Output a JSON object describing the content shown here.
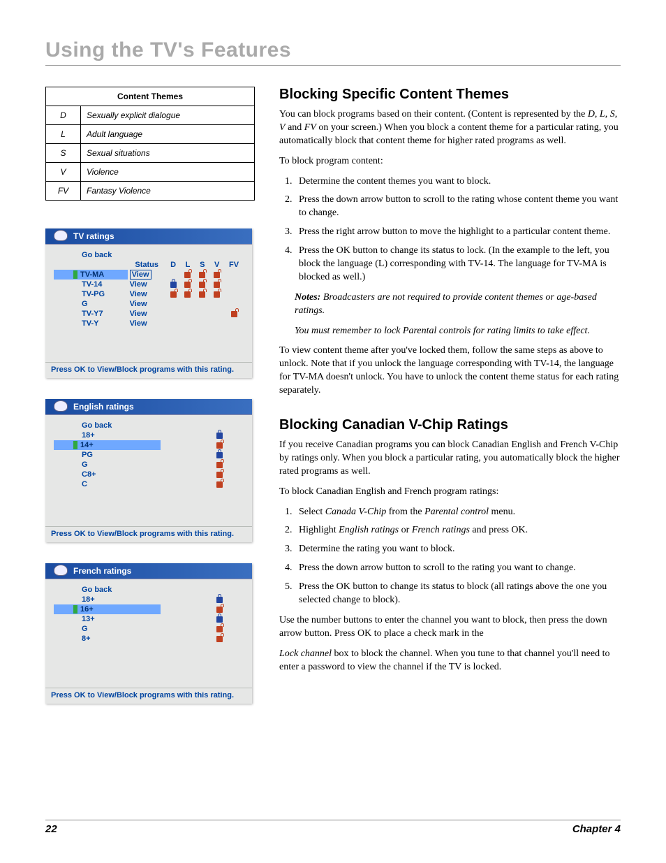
{
  "header": {
    "title": "Using the TV's Features"
  },
  "content_themes": {
    "title": "Content Themes",
    "rows": [
      {
        "code": "D",
        "label": "Sexually explicit dialogue"
      },
      {
        "code": "L",
        "label": "Adult language"
      },
      {
        "code": "S",
        "label": "Sexual situations"
      },
      {
        "code": "V",
        "label": "Violence"
      },
      {
        "code": "FV",
        "label": "Fantasy Violence"
      }
    ]
  },
  "tv_ratings_menu": {
    "title": "TV ratings",
    "go_back": "Go back",
    "columns": [
      "Status",
      "D",
      "L",
      "S",
      "V",
      "FV"
    ],
    "rows": [
      {
        "name": "TV-MA",
        "status": "View",
        "highlight": true,
        "boxed": true,
        "icons": [
          "",
          "unlock",
          "unlock",
          "unlock",
          ""
        ]
      },
      {
        "name": "TV-14",
        "status": "View",
        "highlight": false,
        "boxed": false,
        "icons": [
          "lock",
          "unlock",
          "unlock",
          "unlock",
          ""
        ]
      },
      {
        "name": "TV-PG",
        "status": "View",
        "highlight": false,
        "boxed": false,
        "icons": [
          "unlock",
          "unlock",
          "unlock",
          "unlock",
          ""
        ]
      },
      {
        "name": "G",
        "status": "View",
        "highlight": false,
        "boxed": false,
        "icons": [
          "",
          "",
          "",
          "",
          ""
        ]
      },
      {
        "name": "TV-Y7",
        "status": "View",
        "highlight": false,
        "boxed": false,
        "icons": [
          "",
          "",
          "",
          "",
          "unlock"
        ]
      },
      {
        "name": "TV-Y",
        "status": "View",
        "highlight": false,
        "boxed": false,
        "icons": [
          "",
          "",
          "",
          "",
          ""
        ]
      }
    ],
    "footer": "Press OK to View/Block programs with this rating."
  },
  "english_ratings_menu": {
    "title": "English ratings",
    "go_back": "Go back",
    "rows": [
      {
        "name": "18+",
        "icon": "lock",
        "highlight": false
      },
      {
        "name": "14+",
        "icon": "unlock",
        "highlight": true
      },
      {
        "name": "PG",
        "icon": "lock",
        "highlight": false
      },
      {
        "name": "G",
        "icon": "unlock",
        "highlight": false
      },
      {
        "name": "C8+",
        "icon": "unlock",
        "highlight": false
      },
      {
        "name": "C",
        "icon": "unlock",
        "highlight": false
      }
    ],
    "footer": "Press OK to View/Block programs with this rating."
  },
  "french_ratings_menu": {
    "title": "French ratings",
    "go_back": "Go back",
    "rows": [
      {
        "name": "18+",
        "icon": "lock",
        "highlight": false
      },
      {
        "name": "16+",
        "icon": "unlock",
        "highlight": true
      },
      {
        "name": "13+",
        "icon": "lock",
        "highlight": false
      },
      {
        "name": "G",
        "icon": "unlock",
        "highlight": false
      },
      {
        "name": "8+",
        "icon": "unlock",
        "highlight": false
      }
    ],
    "footer": "Press OK to View/Block programs with this rating."
  },
  "section1": {
    "heading": "Blocking Specific Content Themes",
    "p1a": "You can block programs based on their content. (Content is represented by the ",
    "p1b": "D, L, S, V",
    "p1c": " and ",
    "p1d": "FV",
    "p1e": " on your screen.) When you block a content theme for a particular rating, you automatically block that content theme for higher rated programs as well.",
    "p2": "To block program content:",
    "steps": [
      "Determine the content themes you want to block.",
      "Press the down arrow button to scroll to the rating whose content theme you want to change.",
      "Press the right arrow button to move the highlight to a particular content theme.",
      "Press the OK button to change its status to lock. (In the example to the left, you block the language (L) corresponding with TV-14. The language for TV-MA is blocked as well.)"
    ],
    "notes_label": "Notes:",
    "note1": " Broadcasters are not required to provide content themes or age-based ratings.",
    "note2": "You must remember to lock Parental controls for rating limits to take effect.",
    "p3": "To view content theme after you've locked them, follow the same steps as above to unlock. Note that if you unlock the language corresponding with TV-14, the language for TV-MA doesn't unlock. You have to unlock the content theme status for each rating separately."
  },
  "section2": {
    "heading": "Blocking Canadian V-Chip Ratings",
    "p1": "If you receive Canadian programs you can block Canadian English and French V-Chip by ratings only. When you block a particular rating, you automatically block the higher rated programs as well.",
    "p2": "To block Canadian English and French program ratings:",
    "step1a": "Select ",
    "step1b": "Canada V-Chip",
    "step1c": " from the ",
    "step1d": "Parental control",
    "step1e": " menu.",
    "step2a": "Highlight ",
    "step2b": "English ratings",
    "step2c": " or ",
    "step2d": "French ratings",
    "step2e": " and press OK.",
    "step3": "Determine the rating you want to block.",
    "step4": "Press the down arrow button to scroll to the rating you want to change.",
    "step5": "Press the OK button to change its status to block (all ratings above the one you selected change to block).",
    "p3": "Use the number buttons to enter the channel you want to block, then press the down arrow button. Press OK to place a check mark in the",
    "p4a": "Lock channel",
    "p4b": " box to block the channel. When you tune to that channel you'll need to enter a password to view the channel if the TV is locked."
  },
  "footer": {
    "page": "22",
    "chapter": "Chapter 4"
  }
}
